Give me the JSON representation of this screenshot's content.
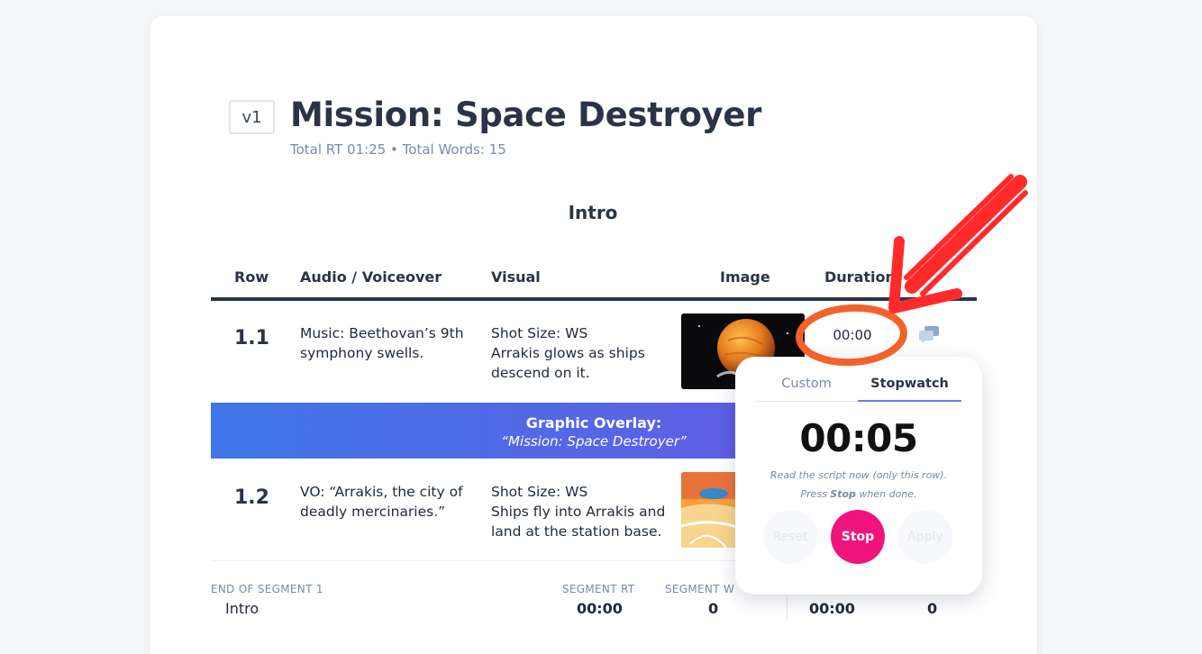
{
  "document": {
    "version": "v1",
    "title": "Mission: Space Destroyer",
    "stats": "Total RT 01:25 • Total Words: 15"
  },
  "segment": {
    "title": "Intro"
  },
  "columns": {
    "row": "Row",
    "audio": "Audio / Voiceover",
    "visual": "Visual",
    "image": "Image",
    "duration": "Duration"
  },
  "rows": [
    {
      "number": "1.1",
      "audio": "Music: Beethovan’s 9th symphony swells.",
      "visual_line1": "Shot Size: WS",
      "visual_line2": "Arrakis glows as ships descend on it.",
      "duration": "00:00",
      "image_icon": "planet-thumbnail"
    },
    {
      "number": "1.2",
      "audio": "VO: “Arrakis, the city of deadly mercinaries.”",
      "visual_line1": "Shot Size: WS",
      "visual_line2": "Ships fly into Arrakis and land at the station base.",
      "image_icon": "desert-ship-thumbnail"
    }
  ],
  "overlay": {
    "title": "Graphic Overlay:",
    "subtitle": "“Mission: Space Destroyer”"
  },
  "footer": {
    "end_label": "END OF SEGMENT 1",
    "segment_name": "Intro",
    "segment_rt_label": "SEGMENT RT",
    "segment_rt_value": "00:00",
    "segment_words_label": "SEGMENT WORDS",
    "segment_words_value": "0",
    "col3_value": "00:00",
    "col4_value": "0"
  },
  "popup": {
    "tab_custom": "Custom",
    "tab_stopwatch": "Stopwatch",
    "timer": "00:05",
    "hint_line1": "Read the script now (only this row).",
    "hint_line2_pre": "Press ",
    "hint_line2_bold": "Stop",
    "hint_line2_post": " when done.",
    "reset": "Reset",
    "stop": "Stop",
    "apply": "Apply"
  },
  "colors": {
    "accent_pink": "#f0157c",
    "overlay_blue": "#3f77ea",
    "overlay_purple": "#6d4de0",
    "annotation_red": "#ff2b2b",
    "annotation_orange": "#f4622a"
  }
}
